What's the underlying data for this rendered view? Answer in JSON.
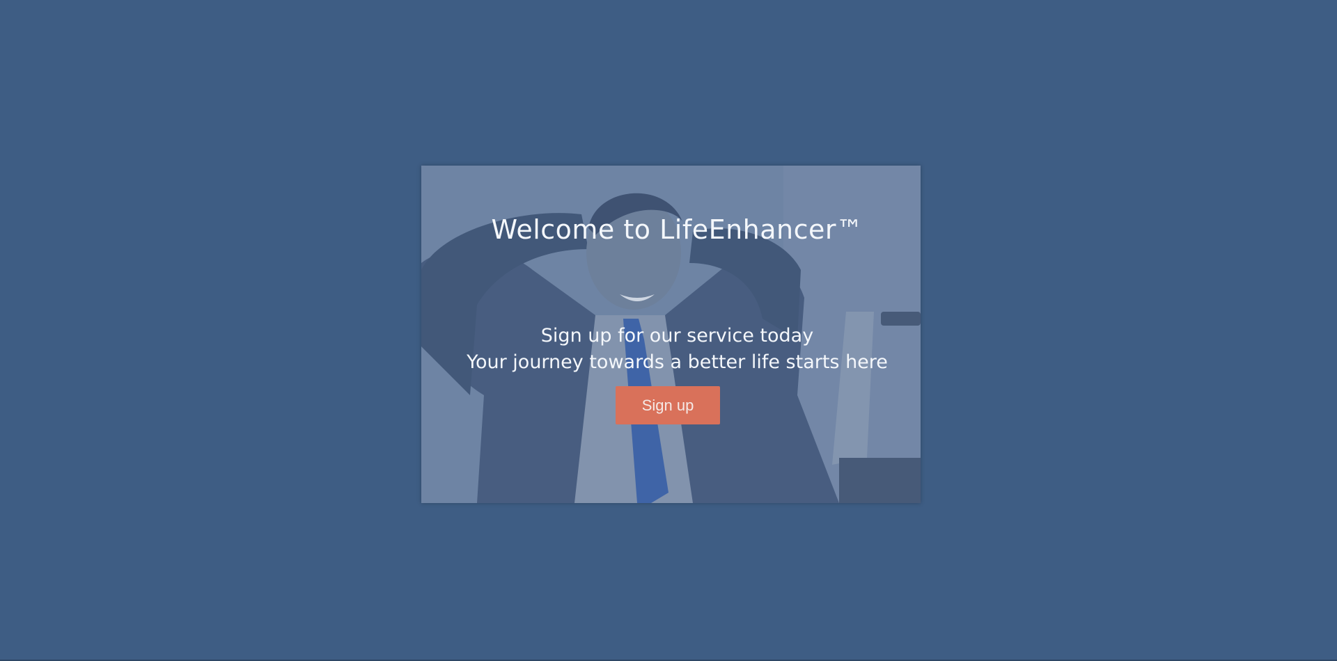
{
  "hero": {
    "title": "Welcome to LifeEnhancer™",
    "subtitle_line1": "Sign up for our service today",
    "subtitle_line2": "Your journey towards a better life starts here",
    "button_label": "Sign up"
  },
  "colors": {
    "page_background": "#3e5d84",
    "card_tint": "#6e84a4",
    "button_background": "#d9715a",
    "text": "#f4f7fb"
  }
}
